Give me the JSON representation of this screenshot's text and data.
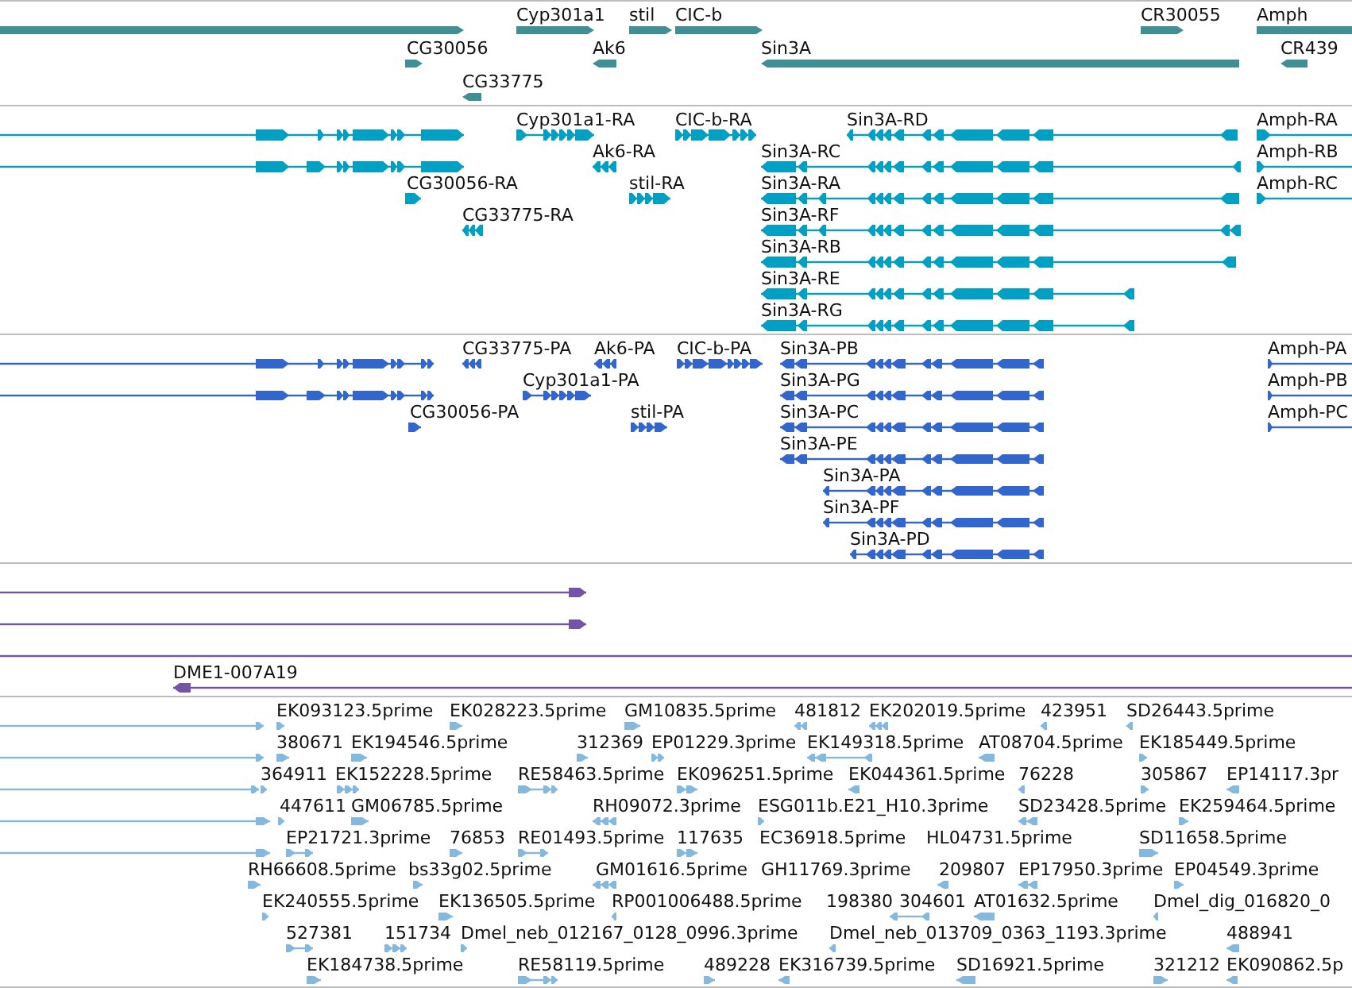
{
  "tracks": [
    {
      "kind": "gene",
      "features": [
        {
          "reverse": false
        },
        {
          "label": "Cyp301a1",
          "reverse": false
        },
        {
          "label": "stil",
          "reverse": false
        },
        {
          "label": "CIC-b",
          "reverse": false
        },
        {
          "label": "CR30055",
          "reverse": false
        },
        {
          "label": "Amph",
          "reverse": false
        },
        {
          "label": "CG30056",
          "reverse": false
        },
        {
          "label": "Ak6",
          "reverse": true
        },
        {
          "label": "Sin3A",
          "reverse": true
        },
        {
          "label": "CR439",
          "reverse": true
        },
        {
          "label": "CG33775",
          "reverse": true
        }
      ]
    },
    {
      "kind": "transcript",
      "features": [
        {
          "reverse": false
        },
        {
          "label": "Cyp301a1-RA",
          "reverse": false
        },
        {
          "label": "CIC-b-RA",
          "reverse": false
        },
        {
          "label": "Sin3A-RD",
          "reverse": true
        },
        {
          "label": "Amph-RA",
          "reverse": false
        },
        {
          "reverse": false
        },
        {
          "label": "Ak6-RA",
          "reverse": true
        },
        {
          "label": "Sin3A-RC",
          "reverse": true
        },
        {
          "label": "Amph-RB",
          "reverse": false
        },
        {
          "label": "CG30056-RA",
          "reverse": false
        },
        {
          "label": "stil-RA",
          "reverse": false
        },
        {
          "label": "Sin3A-RA",
          "reverse": true
        },
        {
          "label": "Amph-RC",
          "reverse": false
        },
        {
          "label": "CG33775-RA",
          "reverse": true
        },
        {
          "label": "Sin3A-RF",
          "reverse": true
        },
        {
          "label": "Sin3A-RB",
          "reverse": true
        },
        {
          "label": "Sin3A-RE",
          "reverse": true
        },
        {
          "label": "Sin3A-RG",
          "reverse": true
        }
      ]
    },
    {
      "kind": "protein",
      "features": [
        {
          "reverse": false
        },
        {
          "label": "CG33775-PA",
          "reverse": true
        },
        {
          "label": "Ak6-PA",
          "reverse": true
        },
        {
          "label": "CIC-b-PA",
          "reverse": false
        },
        {
          "label": "Sin3A-PB",
          "reverse": true
        },
        {
          "label": "Amph-PA",
          "reverse": false
        },
        {
          "reverse": false
        },
        {
          "label": "Cyp301a1-PA",
          "reverse": false
        },
        {
          "label": "Sin3A-PG",
          "reverse": true
        },
        {
          "label": "Amph-PB",
          "reverse": false
        },
        {
          "label": "CG30056-PA",
          "reverse": false
        },
        {
          "label": "stil-PA",
          "reverse": false
        },
        {
          "label": "Sin3A-PC",
          "reverse": true
        },
        {
          "label": "Amph-PC",
          "reverse": false
        },
        {
          "label": "Sin3A-PE",
          "reverse": true
        },
        {
          "label": "Sin3A-PA",
          "reverse": true
        },
        {
          "label": "Sin3A-PF",
          "reverse": true
        },
        {
          "label": "Sin3A-PD",
          "reverse": true
        }
      ]
    },
    {
      "kind": "clone",
      "features": [
        {
          "reverse": false
        },
        {
          "reverse": false
        },
        {
          "label": "DME1-007A19",
          "reverse": true
        }
      ]
    },
    {
      "kind": "est",
      "features": [
        {
          "reverse": false
        },
        {
          "label": "EK093123.5prime",
          "reverse": false
        },
        {
          "label": "EK028223.5prime",
          "reverse": false
        },
        {
          "label": "GM10835.5prime",
          "reverse": false
        },
        {
          "label": "481812",
          "reverse": true
        },
        {
          "label": "EK202019.5prime",
          "reverse": true
        },
        {
          "label": "423951",
          "reverse": true
        },
        {
          "label": "SD26443.5prime",
          "reverse": true
        },
        {
          "reverse": false
        },
        {
          "label": "380671",
          "reverse": false
        },
        {
          "label": "EK194546.5prime",
          "reverse": false
        },
        {
          "label": "312369",
          "reverse": false
        },
        {
          "label": "EP01229.3prime",
          "reverse": false
        },
        {
          "label": "EK149318.5prime",
          "reverse": true
        },
        {
          "label": "AT08704.5prime",
          "reverse": true
        },
        {
          "label": "EK185449.5prime",
          "reverse": false
        },
        {
          "reverse": false
        },
        {
          "label": "364911",
          "reverse": false
        },
        {
          "label": "EK152228.5prime",
          "reverse": false
        },
        {
          "label": "RE58463.5prime",
          "reverse": false
        },
        {
          "label": "EK096251.5prime",
          "reverse": false
        },
        {
          "label": "EK044361.5prime",
          "reverse": true
        },
        {
          "label": "76228",
          "reverse": true
        },
        {
          "label": "305867",
          "reverse": false
        },
        {
          "label": "EP14117.3pr",
          "reverse": true
        },
        {
          "reverse": false
        },
        {
          "label": "447611",
          "reverse": false
        },
        {
          "label": "GM06785.5prime",
          "reverse": false
        },
        {
          "label": "RH09072.3prime",
          "reverse": true
        },
        {
          "label": "ESG011b.E21_H10.3prime",
          "reverse": false
        },
        {
          "label": "SD23428.5prime",
          "reverse": true
        },
        {
          "label": "EK259464.5prime",
          "reverse": false
        },
        {
          "reverse": false
        },
        {
          "label": "EP21721.3prime",
          "reverse": false
        },
        {
          "label": "76853",
          "reverse": false
        },
        {
          "label": "RE01493.5prime",
          "reverse": false
        },
        {
          "label": "117635",
          "reverse": false
        },
        {
          "label": "EC36918.5prime"
        },
        {
          "label": "HL04731.5prime"
        },
        {
          "label": "SD11658.5prime",
          "reverse": false
        },
        {
          "label": "RH66608.5prime",
          "reverse": false
        },
        {
          "label": "bs33g02.5prime",
          "reverse": false
        },
        {
          "label": "GM01616.5prime",
          "reverse": true
        },
        {
          "label": "GH11769.3prime"
        },
        {
          "label": "209807",
          "reverse": true
        },
        {
          "label": "EP17950.3prime",
          "reverse": true
        },
        {
          "label": "EP04549.3prime",
          "reverse": false
        },
        {
          "label": "EK240555.5prime",
          "reverse": false
        },
        {
          "label": "EK136505.5prime",
          "reverse": false
        },
        {
          "label": "RP001006488.5prime",
          "reverse": true
        },
        {
          "label": "198380"
        },
        {
          "label": "304601",
          "reverse": true
        },
        {
          "label": "AT01632.5prime",
          "reverse": true
        },
        {
          "label": "Dmel_dig_016820_0",
          "reverse": true
        },
        {
          "label": "527381",
          "reverse": false
        },
        {
          "label": "151734",
          "reverse": false
        },
        {
          "label": "Dmel_neb_012167_0128_0996.3prime",
          "reverse": false
        },
        {
          "label": "Dmel_neb_013709_0363_1193.3prime",
          "reverse": true
        },
        {
          "label": "488941",
          "reverse": true
        },
        {
          "label": "EK184738.5prime",
          "reverse": false
        },
        {
          "label": "RE58119.5prime",
          "reverse": false
        },
        {
          "label": "489228",
          "reverse": false
        },
        {
          "label": "EK316739.5prime",
          "reverse": true
        },
        {
          "label": "SD16921.5prime",
          "reverse": true
        },
        {
          "label": "321212",
          "reverse": false
        },
        {
          "label": "EK090862.5p",
          "reverse": true
        }
      ]
    }
  ]
}
